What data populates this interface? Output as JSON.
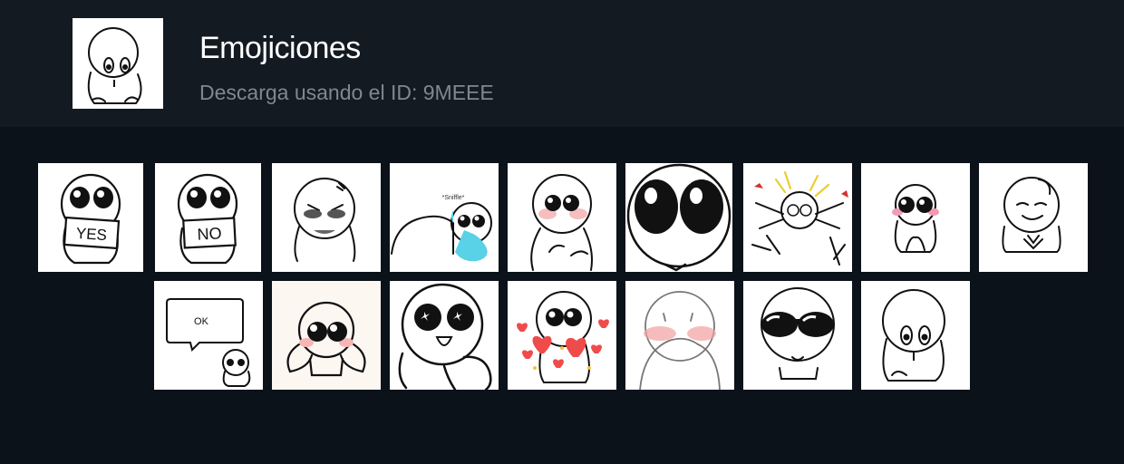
{
  "pack": {
    "title": "Emojiciones",
    "subtitle": "Descarga usando el ID: 9MEEE",
    "cover_icon": "shy-character-icon"
  },
  "colors": {
    "background": "#0c121a",
    "header_background": "#131a22",
    "title": "#ffffff",
    "subtitle": "#7f8790",
    "sticker_tile": "#ffffff"
  },
  "stickers": {
    "yes_sign_text": "YES",
    "no_sign_text": "NO",
    "sniffle_text": "*Sniffle*",
    "speech_bubble_text": "OK"
  },
  "sticker_list": [
    "yes-sign-sticker",
    "no-sign-sticker",
    "angry-sticker",
    "crying-sniffle-sticker",
    "teary-blush-sticker",
    "big-eyes-closeup-sticker",
    "excited-arms-sticker",
    "small-blush-sticker",
    "smug-smile-sticker",
    "ok-speech-bubble-sticker",
    "blushing-hug-sticker",
    "sparkle-eyes-sticker",
    "hearts-sticker",
    "hiding-face-sticker",
    "sunglasses-sticker",
    "shy-pout-sticker"
  ]
}
